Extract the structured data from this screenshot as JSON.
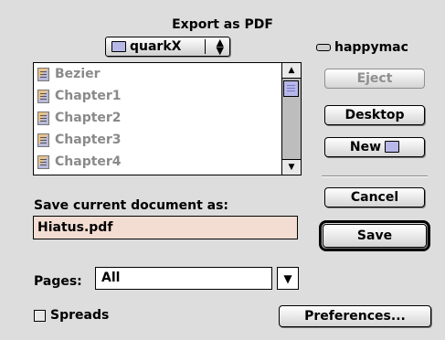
{
  "dialog": {
    "title": "Export as PDF",
    "folder_popup": {
      "label": "quarkX",
      "icon": "folder-icon",
      "arrows": "▲\n▼"
    },
    "disk": {
      "label": "happymac",
      "icon": "disk-icon"
    }
  },
  "files": [
    {
      "name": "Bezier",
      "icon": "document-icon"
    },
    {
      "name": "Chapter1",
      "icon": "document-icon"
    },
    {
      "name": "Chapter2",
      "icon": "document-icon"
    },
    {
      "name": "Chapter3",
      "icon": "document-icon"
    },
    {
      "name": "Chapter4",
      "icon": "document-icon"
    }
  ],
  "scroll": {
    "up": "▲",
    "down": "▼"
  },
  "buttons": {
    "eject": "Eject",
    "desktop": "Desktop",
    "new": "New",
    "cancel": "Cancel",
    "save": "Save",
    "preferences": "Preferences..."
  },
  "save_as": {
    "label": "Save current document as:",
    "value": "Hiatus.pdf"
  },
  "pages": {
    "label": "Pages:",
    "value": "All",
    "arrow": "▼"
  },
  "spreads": {
    "label": "Spreads",
    "checked": false
  },
  "colors": {
    "background": "#dddddd",
    "field_fill": "#f3ddd2",
    "disabled_text": "#8a8a8a"
  }
}
